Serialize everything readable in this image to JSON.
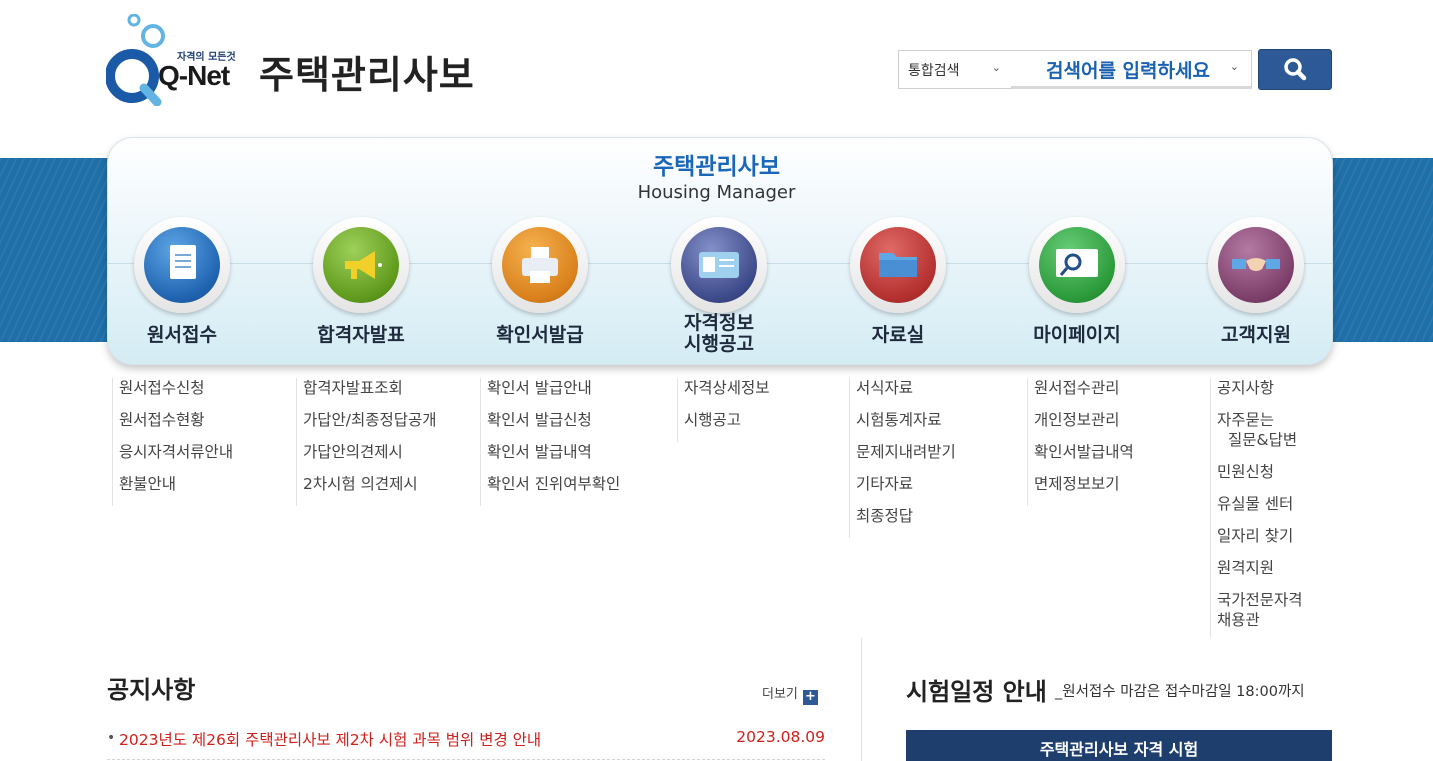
{
  "header": {
    "logo": {
      "tagline": "자격의 모든것",
      "brand": "Q-Net"
    },
    "site_title": "주택관리사보"
  },
  "search": {
    "scope": "통합검색",
    "placeholder": "검색어를 입력하세요",
    "button_icon": "search-icon"
  },
  "hero": {
    "title": "주택관리사보",
    "subtitle": "Housing Manager"
  },
  "categories": [
    {
      "label": "원서접수",
      "icon": "application-form-icon",
      "color": "#1f63b0"
    },
    {
      "label": "합격자발표",
      "icon": "megaphone-icon",
      "color": "#5f9a1c"
    },
    {
      "label": "확인서발급",
      "icon": "printer-icon",
      "color": "#d9801c"
    },
    {
      "label_line1": "자격정보",
      "label_line2": "시행공고",
      "icon": "id-card-icon",
      "color": "#3d4a8a"
    },
    {
      "label": "자료실",
      "icon": "folder-icon",
      "color": "#b3302f"
    },
    {
      "label": "마이페이지",
      "icon": "monitor-search-icon",
      "color": "#2b9a3a"
    },
    {
      "label": "고객지원",
      "icon": "handshake-icon",
      "color": "#7c3f6a"
    }
  ],
  "submenus": {
    "col1": [
      "원서접수신청",
      "원서접수현황",
      "응시자격서류안내",
      "환불안내"
    ],
    "col2": [
      "합격자발표조회",
      "가답안/최종정답공개",
      "가답안의견제시",
      "2차시험 의견제시"
    ],
    "col3": [
      "확인서 발급안내",
      "확인서 발급신청",
      "확인서 발급내역",
      "확인서 진위여부확인"
    ],
    "col4": [
      "자격상세정보",
      "시행공고"
    ],
    "col5": [
      "서식자료",
      "시험통계자료",
      "문제지내려받기",
      "기타자료",
      "최종정답"
    ],
    "col6": [
      "원서접수관리",
      "개인정보관리",
      "확인서발급내역",
      "면제정보보기"
    ],
    "col7": [
      "공지사항",
      "자주묻는",
      "질문&답변",
      "민원신청",
      "유실물 센터",
      "일자리 찾기",
      "원격지원",
      "국가전문자격",
      "채용관"
    ]
  },
  "notices": {
    "title": "공지사항",
    "more_label": "더보기",
    "items": [
      {
        "text": "2023년도 제26회 주택관리사보 제2차 시험 과목 범위 변경 안내",
        "date": "2023.08.09"
      }
    ]
  },
  "schedule": {
    "title": "시험일정 안내",
    "note": "_원서접수 마감은 접수마감일 18:00까지",
    "bar_label": "주택관리사보 자격 시험"
  }
}
